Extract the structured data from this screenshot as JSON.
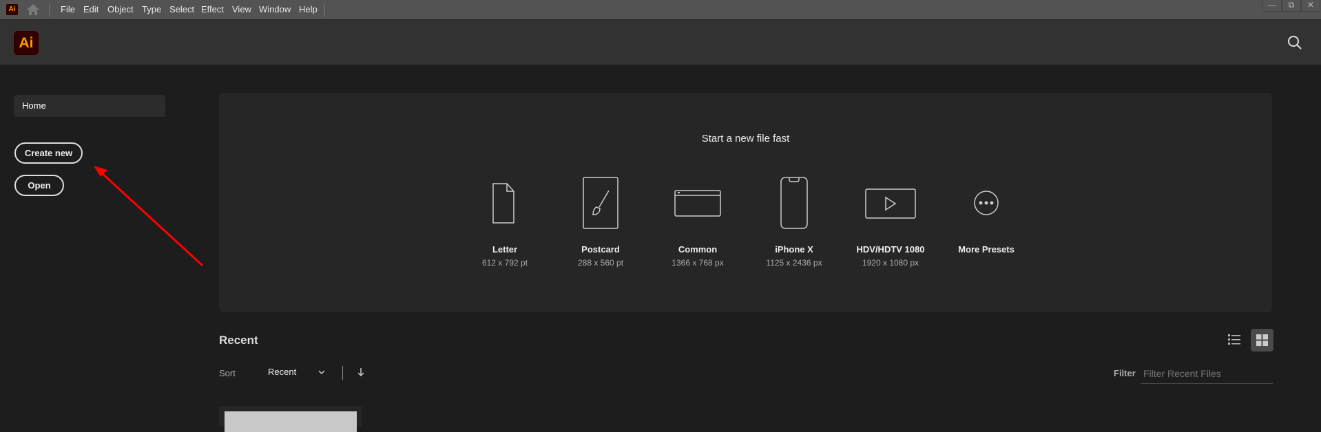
{
  "menubar": {
    "items": [
      "File",
      "Edit",
      "Object",
      "Type",
      "Select",
      "Effect",
      "View",
      "Window",
      "Help"
    ]
  },
  "app": {
    "logo_text": "Ai",
    "brand_color": "#ff9a00",
    "logo_bg": "#330000"
  },
  "sidebar": {
    "home": "Home",
    "create_new": "Create new",
    "open": "Open"
  },
  "start": {
    "title": "Start a new file fast",
    "presets": [
      {
        "label": "Letter",
        "size": "612 x 792 pt",
        "icon": "document-icon"
      },
      {
        "label": "Postcard",
        "size": "288 x 560 pt",
        "icon": "brush-icon"
      },
      {
        "label": "Common",
        "size": "1366 x 768 px",
        "icon": "browser-window-icon"
      },
      {
        "label": "iPhone X",
        "size": "1125 x 2436 px",
        "icon": "phone-icon"
      },
      {
        "label": "HDV/HDTV 1080",
        "size": "1920 x 1080 px",
        "icon": "video-icon"
      },
      {
        "label": "More Presets",
        "size": "",
        "icon": "more-icon"
      }
    ]
  },
  "recent": {
    "title": "Recent",
    "sort_label": "Sort",
    "sort_value": "Recent",
    "filter_label": "Filter",
    "filter_placeholder": "Filter Recent Files",
    "view_mode": "grid"
  },
  "annotation": {
    "arrow_color": "#ff0000"
  }
}
